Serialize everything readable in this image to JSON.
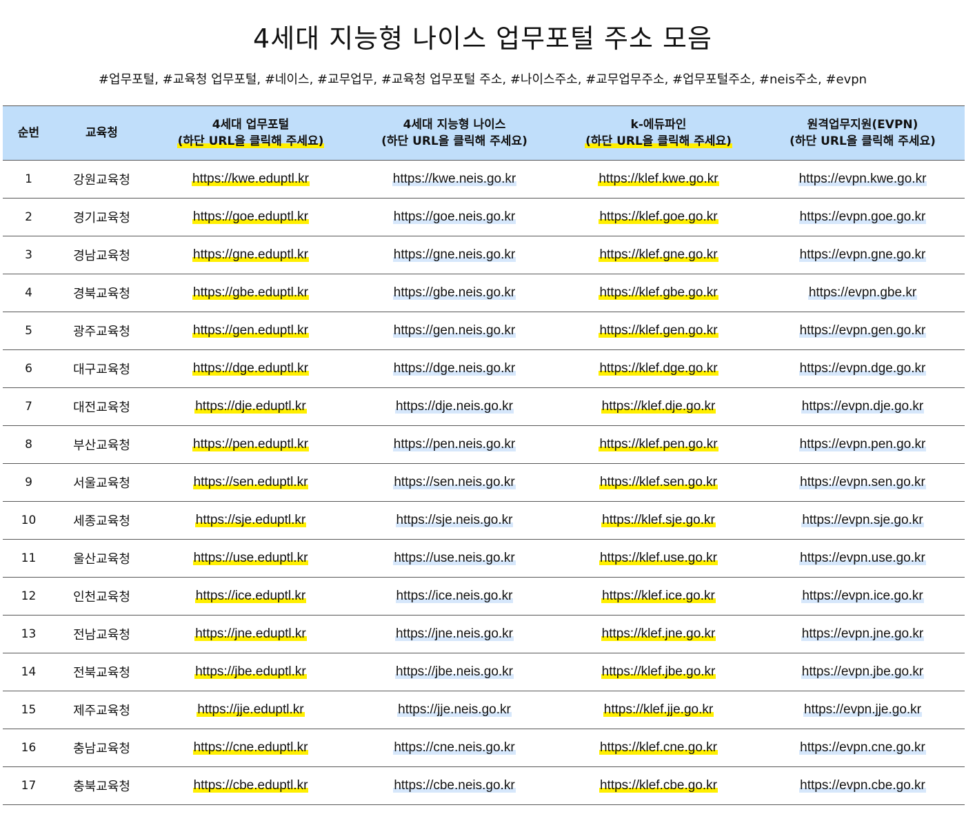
{
  "title": "4세대 지능형 나이스 업무포털 주소 모음",
  "tags": "#업무포털, #교육청 업무포털, #네이스, #교무업무, #교육청 업무포털 주소, #나이스주소, #교무업무주소, #업무포털주소, #neis주소, #evpn",
  "table": {
    "headers": {
      "num": "순번",
      "office": "교육청",
      "portal_line1": "4세대 업무포털",
      "portal_line2": "(하단 URL을 클릭해 주세요)",
      "neis_line1": "4세대 지능형 나이스",
      "neis_line2": "(하단 URL을 클릭해 주세요)",
      "edufine_line1": "k-에듀파인",
      "edufine_line2": "(하단 URL을 클릭해 주세요)",
      "evpn_line1": "원격업무지원(EVPN)",
      "evpn_line2": "(하단 URL을 클릭해 주세요)"
    },
    "rows": [
      {
        "num": "1",
        "office": "강원교육청",
        "portal": "https://kwe.eduptl.kr",
        "neis": "https://kwe.neis.go.kr",
        "edufine": "https://klef.kwe.go.kr",
        "evpn": "https://evpn.kwe.go.kr"
      },
      {
        "num": "2",
        "office": "경기교육청",
        "portal": "https://goe.eduptl.kr",
        "neis": "https://goe.neis.go.kr",
        "edufine": "https://klef.goe.go.kr",
        "evpn": "https://evpn.goe.go.kr"
      },
      {
        "num": "3",
        "office": "경남교육청",
        "portal": "https://gne.eduptl.kr",
        "neis": "https://gne.neis.go.kr",
        "edufine": "https://klef.gne.go.kr",
        "evpn": "https://evpn.gne.go.kr"
      },
      {
        "num": "4",
        "office": "경북교육청",
        "portal": "https://gbe.eduptl.kr",
        "neis": "https://gbe.neis.go.kr",
        "edufine": "https://klef.gbe.go.kr",
        "evpn": "https://evpn.gbe.kr"
      },
      {
        "num": "5",
        "office": "광주교육청",
        "portal": "https://gen.eduptl.kr",
        "neis": "https://gen.neis.go.kr",
        "edufine": "https://klef.gen.go.kr",
        "evpn": "https://evpn.gen.go.kr"
      },
      {
        "num": "6",
        "office": "대구교육청",
        "portal": "https://dge.eduptl.kr",
        "neis": "https://dge.neis.go.kr",
        "edufine": "https://klef.dge.go.kr",
        "evpn": "https://evpn.dge.go.kr"
      },
      {
        "num": "7",
        "office": "대전교육청",
        "portal": "https://dje.eduptl.kr",
        "neis": "https://dje.neis.go.kr",
        "edufine": "https://klef.dje.go.kr",
        "evpn": "https://evpn.dje.go.kr"
      },
      {
        "num": "8",
        "office": "부산교육청",
        "portal": "https://pen.eduptl.kr",
        "neis": "https://pen.neis.go.kr",
        "edufine": "https://klef.pen.go.kr",
        "evpn": "https://evpn.pen.go.kr"
      },
      {
        "num": "9",
        "office": "서울교육청",
        "portal": "https://sen.eduptl.kr",
        "neis": "https://sen.neis.go.kr",
        "edufine": "https://klef.sen.go.kr",
        "evpn": "https://evpn.sen.go.kr"
      },
      {
        "num": "10",
        "office": "세종교육청",
        "portal": "https://sje.eduptl.kr",
        "neis": "https://sje.neis.go.kr",
        "edufine": "https://klef.sje.go.kr",
        "evpn": "https://evpn.sje.go.kr"
      },
      {
        "num": "11",
        "office": "울산교육청",
        "portal": "https://use.eduptl.kr",
        "neis": "https://use.neis.go.kr",
        "edufine": "https://klef.use.go.kr",
        "evpn": "https://evpn.use.go.kr"
      },
      {
        "num": "12",
        "office": "인천교육청",
        "portal": "https://ice.eduptl.kr",
        "neis": "https://ice.neis.go.kr",
        "edufine": "https://klef.ice.go.kr",
        "evpn": "https://evpn.ice.go.kr"
      },
      {
        "num": "13",
        "office": "전남교육청",
        "portal": "https://jne.eduptl.kr",
        "neis": "https://jne.neis.go.kr",
        "edufine": "https://klef.jne.go.kr",
        "evpn": "https://evpn.jne.go.kr"
      },
      {
        "num": "14",
        "office": "전북교육청",
        "portal": "https://jbe.eduptl.kr",
        "neis": "https://jbe.neis.go.kr",
        "edufine": "https://klef.jbe.go.kr",
        "evpn": "https://evpn.jbe.go.kr"
      },
      {
        "num": "15",
        "office": "제주교육청",
        "portal": "https://jje.eduptl.kr",
        "neis": "https://jje.neis.go.kr",
        "edufine": "https://klef.jje.go.kr",
        "evpn": "https://evpn.jje.go.kr"
      },
      {
        "num": "16",
        "office": "충남교육청",
        "portal": "https://cne.eduptl.kr",
        "neis": "https://cne.neis.go.kr",
        "edufine": "https://klef.cne.go.kr",
        "evpn": "https://evpn.cne.go.kr"
      },
      {
        "num": "17",
        "office": "충북교육청",
        "portal": "https://cbe.eduptl.kr",
        "neis": "https://cbe.neis.go.kr",
        "edufine": "https://klef.cbe.go.kr",
        "evpn": "https://evpn.cbe.go.kr"
      }
    ]
  },
  "colors": {
    "header_bg": "#c0defa",
    "highlight_yellow": "#ffef00",
    "highlight_blue": "#d6e7fb",
    "rule": "#555555"
  }
}
